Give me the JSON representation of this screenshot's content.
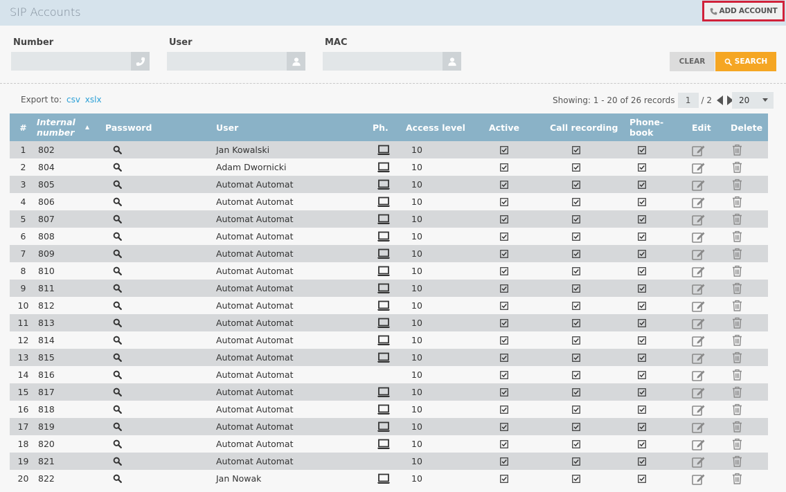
{
  "header": {
    "title": "SIP Accounts",
    "add_account_label": "ADD ACCOUNT"
  },
  "filters": {
    "number_label": "Number",
    "number_value": "",
    "user_label": "User",
    "user_value": "",
    "mac_label": "MAC",
    "mac_value": ""
  },
  "buttons": {
    "clear_label": "CLEAR",
    "search_label": "SEARCH"
  },
  "export": {
    "label": "Export to:",
    "csv": "csv",
    "xslx": "xslx"
  },
  "pagination": {
    "showing": "Showing: 1 - 20 of 26 records",
    "page": "1",
    "total": "/ 2",
    "per_page": "20"
  },
  "table": {
    "columns": [
      "#",
      "Internal number",
      "Password",
      "User",
      "Ph.",
      "Access level",
      "Active",
      "Call recording",
      "Phone-book",
      "Edit",
      "Delete"
    ],
    "rows": [
      {
        "n": "1",
        "num": "802",
        "user": "Jan Kowalski",
        "phone": true,
        "level": "10"
      },
      {
        "n": "2",
        "num": "804",
        "user": "Adam Dwornicki",
        "phone": true,
        "level": "10"
      },
      {
        "n": "3",
        "num": "805",
        "user": "Automat Automat",
        "phone": true,
        "level": "10"
      },
      {
        "n": "4",
        "num": "806",
        "user": "Automat Automat",
        "phone": true,
        "level": "10"
      },
      {
        "n": "5",
        "num": "807",
        "user": "Automat Automat",
        "phone": true,
        "level": "10"
      },
      {
        "n": "6",
        "num": "808",
        "user": "Automat Automat",
        "phone": true,
        "level": "10"
      },
      {
        "n": "7",
        "num": "809",
        "user": "Automat Automat",
        "phone": true,
        "level": "10"
      },
      {
        "n": "8",
        "num": "810",
        "user": "Automat Automat",
        "phone": true,
        "level": "10"
      },
      {
        "n": "9",
        "num": "811",
        "user": "Automat Automat",
        "phone": true,
        "level": "10"
      },
      {
        "n": "10",
        "num": "812",
        "user": "Automat Automat",
        "phone": true,
        "level": "10"
      },
      {
        "n": "11",
        "num": "813",
        "user": "Automat Automat",
        "phone": true,
        "level": "10"
      },
      {
        "n": "12",
        "num": "814",
        "user": "Automat Automat",
        "phone": true,
        "level": "10"
      },
      {
        "n": "13",
        "num": "815",
        "user": "Automat Automat",
        "phone": true,
        "level": "10"
      },
      {
        "n": "14",
        "num": "816",
        "user": "Automat Automat",
        "phone": false,
        "level": "10"
      },
      {
        "n": "15",
        "num": "817",
        "user": "Automat Automat",
        "phone": true,
        "level": "10"
      },
      {
        "n": "16",
        "num": "818",
        "user": "Automat Automat",
        "phone": true,
        "level": "10"
      },
      {
        "n": "17",
        "num": "819",
        "user": "Automat Automat",
        "phone": true,
        "level": "10"
      },
      {
        "n": "18",
        "num": "820",
        "user": "Automat Automat",
        "phone": true,
        "level": "10"
      },
      {
        "n": "19",
        "num": "821",
        "user": "Automat Automat",
        "phone": false,
        "level": "10"
      },
      {
        "n": "20",
        "num": "822",
        "user": "Jan Nowak",
        "phone": true,
        "level": "10"
      }
    ]
  },
  "icons": {
    "phone": "phone-icon",
    "user": "user-icon",
    "search": "search-icon",
    "device": "laptop-icon",
    "check": "checked-checkbox-icon",
    "edit": "edit-icon",
    "delete": "trash-icon"
  },
  "colors": {
    "header_bg": "#d6e3ec",
    "table_header": "#8ab2c7",
    "search_btn": "#f5a623",
    "highlight_border": "#d0213a",
    "link": "#2a9fd6"
  }
}
